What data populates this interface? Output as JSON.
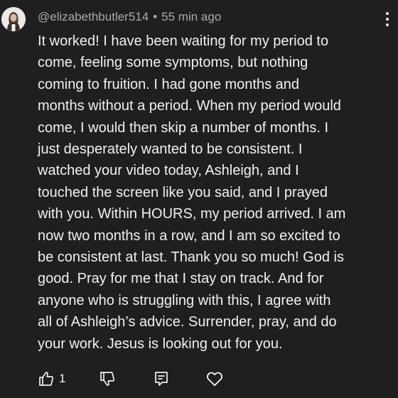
{
  "comment": {
    "author": "@elizabethbutler514",
    "separator": "•",
    "timestamp": "55 min ago",
    "text": "It worked! I have been waiting for my period to\ncome, feeling some symptoms, but nothing\ncoming to fruition. I had gone months and\nmonths without a period. When my period would\ncome, I would then skip a number of months. I\njust desperately wanted to be consistent. I\nwatched your video today, Ashleigh, and I\ntouched the screen like you said, and I prayed\nwith you. Within HOURS, my period arrived. I am\nnow two months in a row, and I am so excited to\nbe consistent at last. Thank you so much! God is\ngood. Pray for me that I stay on track. And for\nanyone who is struggling with this, I agree with\nall of Ashleigh’s advice. Surrender, pray, and do\nyour work. Jesus is looking out for you.",
    "like_count": "1"
  },
  "icons": {
    "avatar": "user-avatar-photo",
    "more": "more-vertical-icon",
    "like": "thumbs-up-icon",
    "dislike": "thumbs-down-icon",
    "reply": "reply-comment-icon",
    "heart": "heart-icon"
  },
  "colors": {
    "background": "#1f1f1f",
    "text": "#f1f1f1",
    "meta": "#aaaaaa"
  }
}
